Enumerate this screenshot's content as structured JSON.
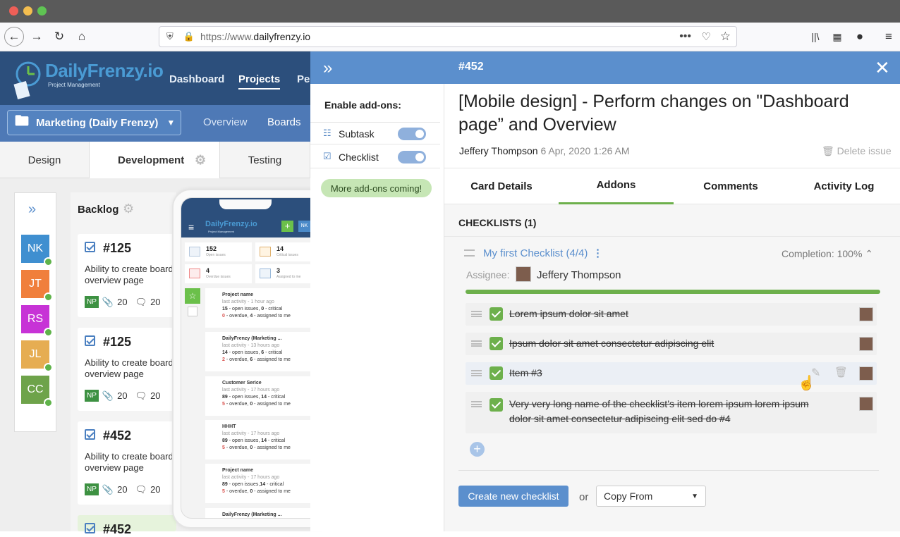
{
  "browser": {
    "url_prefix": "https://www.",
    "url_domain": "dailyfrenzy.io"
  },
  "app": {
    "logo": "DailyFrenzy.io",
    "logo_sub": "Project Management",
    "nav": [
      "Dashboard",
      "Projects",
      "Pe"
    ],
    "project_selector": "Marketing (Daily Frenzy)",
    "subnav": [
      "Overview",
      "Boards"
    ],
    "board_tabs": [
      "Design",
      "Development",
      "Testing"
    ],
    "users": [
      {
        "initials": "NK",
        "color": "#3f8fd0"
      },
      {
        "initials": "JT",
        "color": "#f07f3c"
      },
      {
        "initials": "RS",
        "color": "#c733d6"
      },
      {
        "initials": "JL",
        "color": "#e6ad52"
      },
      {
        "initials": "CC",
        "color": "#6ea34a"
      }
    ],
    "backlog_title": "Backlog",
    "cards": [
      {
        "id": "#125",
        "desc1": "Ability to create board",
        "desc2": "overview page",
        "badge": "NP",
        "attach": "20",
        "comments": "20"
      },
      {
        "id": "#125",
        "desc1": "Ability to create board",
        "desc2": "overview page",
        "badge": "NP",
        "attach": "20",
        "comments": "20"
      },
      {
        "id": "#452",
        "desc1": "Ability to create board",
        "desc2": "overview page",
        "badge": "NP",
        "attach": "20",
        "comments": "20"
      },
      {
        "id": "#452"
      }
    ]
  },
  "phone": {
    "logo": "DailyFrenzy.io",
    "logo_sub": "Project Management",
    "user": "NK",
    "stats": [
      {
        "value": "152",
        "label": "Open issues"
      },
      {
        "value": "14",
        "label": "Critical issues"
      },
      {
        "value": "4",
        "label": "Overdue issues"
      },
      {
        "value": "3",
        "label": "Assigned to me"
      }
    ],
    "projects": [
      {
        "name": "Project name",
        "activity": "last activity - 1 hour ago",
        "open": "15",
        "critical": "0",
        "overdue": "0",
        "assigned": "4"
      },
      {
        "name": "DailyFrenzy (Marketing ...",
        "activity": "last activity - 13 hours ago",
        "open": "14",
        "critical": "6",
        "overdue": "2",
        "assigned": "6"
      },
      {
        "name": "Customer Serice",
        "activity": "last activity - 17 hours ago",
        "open": "89",
        "critical": "14",
        "overdue": "5",
        "assigned": "0"
      },
      {
        "name": "HHHT",
        "activity": "last activity - 17 hours ago",
        "open": "89",
        "critical": "14",
        "overdue": "5",
        "assigned": "0"
      },
      {
        "name": "Project name",
        "activity": "last activity - 17 hours ago",
        "open": "89",
        "critical": "14",
        "overdue": "5",
        "assigned": "0"
      },
      {
        "name": "DailyFrenzy (Marketing ...",
        "activity": "",
        "open": "",
        "critical": "",
        "overdue": "",
        "assigned": ""
      }
    ],
    "open_label": " - open issues, ",
    "open_label_alt": " - open issues,",
    "critical_label": " - critical",
    "overdue_label": " - overdue, ",
    "assigned_label": " - assigned to me"
  },
  "panel": {
    "issue_number": "#452",
    "enable_addons": "Enable add-ons:",
    "addons": [
      {
        "label": "Subtask",
        "enabled": true
      },
      {
        "label": "Checklist",
        "enabled": true
      }
    ],
    "more_addons": "More add-ons coming!"
  },
  "issue": {
    "title": "[Mobile design] - Perform changes on \"Dashboard page” and Overview",
    "author": "Jeffery Thompson",
    "date": "6 Apr, 2020 1:26 AM",
    "delete": "Delete issue",
    "tabs": [
      "Card Details",
      "Addons",
      "Comments",
      "Activity Log"
    ],
    "active_tab": 1
  },
  "checklists": {
    "header": "CHECKLISTS (1)",
    "name": "My first Checklist (4/4)",
    "completion": "Completion: 100%",
    "completion_value": 1.0,
    "assignee_label": "Assignee:",
    "assignee": "Jeffery Thompson",
    "items": [
      {
        "text": "Lorem ipsum dolor sit amet",
        "done": true
      },
      {
        "text": "Ipsum dolor sit amet consectetur adipiscing elit",
        "done": true
      },
      {
        "text": "Item #3",
        "done": true
      },
      {
        "text": "Very very long name of the checklist’s item lorem ipsum lorem ipsum dolor sit amet consectetur adipiscing elit sed do #4",
        "done": true
      }
    ],
    "create_button": "Create new checklist",
    "or": "or",
    "copy_from": "Copy From"
  },
  "colors": {
    "accent": "#5b8fcd",
    "header_dark": "#2c4f7c",
    "success": "#6db04c"
  }
}
